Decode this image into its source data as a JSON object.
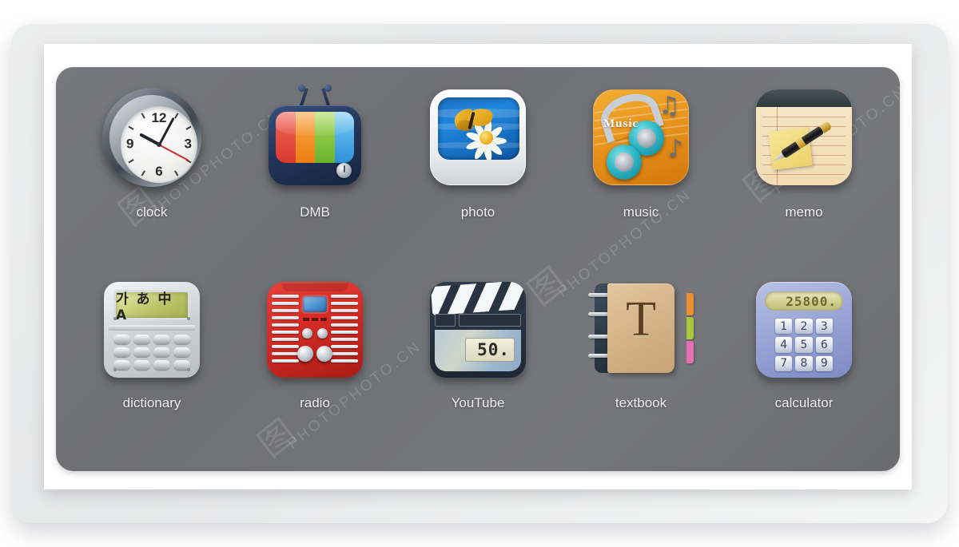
{
  "app": {
    "panel_bg": "#727377",
    "card_bg": "#ffffff",
    "backdrop_bg": "#ebecec",
    "label_color": "#f2f2f2"
  },
  "watermark": {
    "text": "PHOTOPHOTO.CN",
    "logo_glyph": "图"
  },
  "grid": {
    "rows": [
      {
        "items": [
          {
            "id": "clock",
            "label": "clock",
            "icon": "clock-icon"
          },
          {
            "id": "dmb",
            "label": "DMB",
            "icon": "television-icon"
          },
          {
            "id": "photo",
            "label": "photo",
            "icon": "photo-icon"
          },
          {
            "id": "music",
            "label": "music",
            "icon": "music-headphones-icon"
          },
          {
            "id": "memo",
            "label": "memo",
            "icon": "memo-notepad-icon"
          }
        ]
      },
      {
        "items": [
          {
            "id": "dictionary",
            "label": "dictionary",
            "icon": "dictionary-icon"
          },
          {
            "id": "radio",
            "label": "radio",
            "icon": "radio-icon"
          },
          {
            "id": "youtube",
            "label": "YouTube",
            "icon": "clapperboard-icon"
          },
          {
            "id": "textbook",
            "label": "textbook",
            "icon": "textbook-icon"
          },
          {
            "id": "calculator",
            "label": "calculator",
            "icon": "calculator-icon"
          }
        ]
      }
    ]
  },
  "icons": {
    "clock": {
      "numerals": [
        "12",
        "3",
        "6",
        "9"
      ],
      "hour_hand_deg": -62,
      "minute_hand_deg": 28,
      "second_hand_deg": 118,
      "second_hand_color": "#cf2b2b"
    },
    "dmb": {
      "screen_bars": [
        "#ec4a3e",
        "#f08a2b",
        "#7cc13c",
        "#43a7e8"
      ]
    },
    "music": {
      "overlay_text": "Music",
      "background": "#e8941d",
      "cup_color": "#2eb8c6"
    },
    "dictionary": {
      "screen_text": "가 あ 中 A",
      "screen_color": "#b9c267",
      "key_rows": 3,
      "key_cols": 4
    },
    "radio": {
      "body_color": "#d32b24",
      "display_color": "#4a8fcf"
    },
    "youtube": {
      "lcd_text": "50."
    },
    "textbook": {
      "cover_letter": "T",
      "tab_colors": [
        "#ef8d33",
        "#a9c83a",
        "#e86fb4"
      ]
    },
    "calculator": {
      "display_value": "25800.",
      "keys": [
        "1",
        "2",
        "3",
        "4",
        "5",
        "6",
        "7",
        "8",
        "9"
      ],
      "body_color": "#9aa6d6",
      "lcd_color": "#cfcd8e"
    }
  }
}
